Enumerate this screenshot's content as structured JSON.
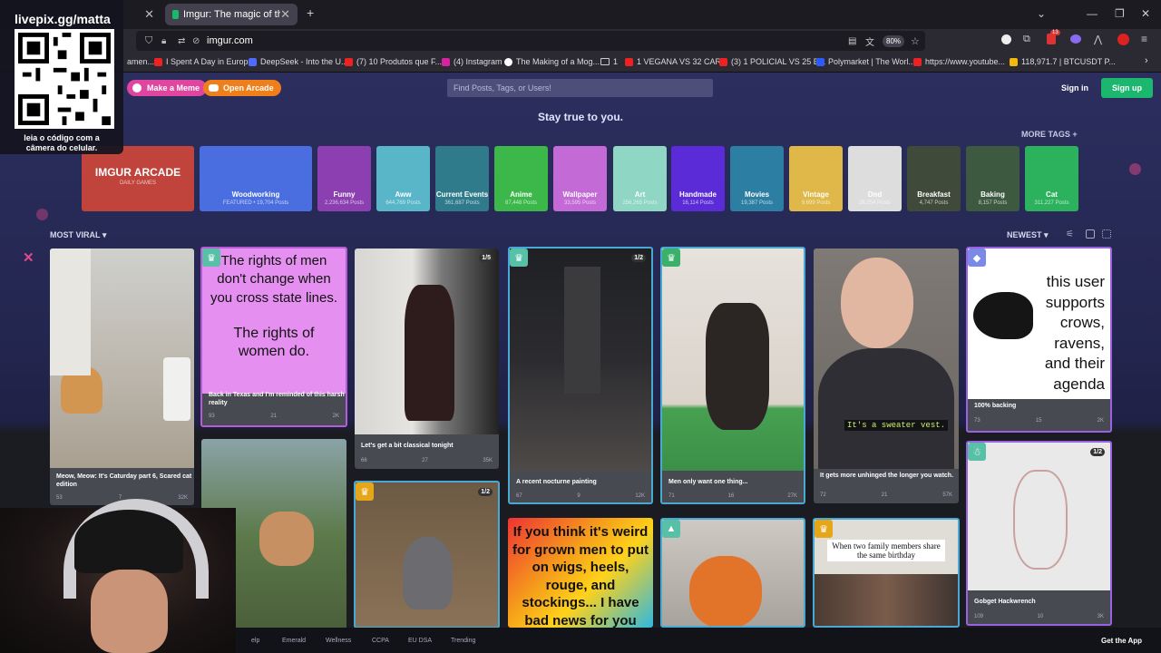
{
  "browser": {
    "tabs": [
      {
        "label": "",
        "active": false
      },
      {
        "label": "Imgur: The magic of the Interne",
        "active": true
      }
    ],
    "new_tab": "+",
    "url": "imgur.com",
    "zoom": "80%",
    "bookmarks": [
      {
        "label": "amen...",
        "color": "#c33"
      },
      {
        "label": "I Spent A Day in Europ...",
        "color": "#e22"
      },
      {
        "label": "DeepSeek - Into the U...",
        "color": "#4d6bfe"
      },
      {
        "label": "(7) 10 Produtos que F...",
        "color": "#e22"
      },
      {
        "label": "(4) Instagram",
        "color": "#d6249f"
      },
      {
        "label": "The Making of a Mog...",
        "color": "#fff"
      },
      {
        "label": "1",
        "color": "#aaa"
      },
      {
        "label": "1 VEGANA VS 32 CAR...",
        "color": "#e22"
      },
      {
        "label": "(3) 1 POLICIAL VS 25 E...",
        "color": "#e22"
      },
      {
        "label": "Polymarket | The Worl...",
        "color": "#2e5bff"
      },
      {
        "label": "https://www.youtube...",
        "color": "#e22"
      },
      {
        "label": "118,971.7 | BTCUSDT P...",
        "color": "#f0b90b"
      }
    ],
    "ext_badge": "13"
  },
  "header": {
    "make_meme": "Make a Meme",
    "open_arcade": "Open Arcade",
    "search_placeholder": "Find Posts, Tags, or Users!",
    "sign_in": "Sign in",
    "sign_up": "Sign up",
    "tagline": "Stay true to you.",
    "more_tags": "MORE TAGS +"
  },
  "tags": [
    {
      "name": "IMGUR ARCADE",
      "count": "DAILY GAMES",
      "color": "#c0443c"
    },
    {
      "name": "Woodworking",
      "count": "FEATURED • 19,704 Posts",
      "color": "#4a6ee0"
    },
    {
      "name": "Funny",
      "count": "2,236,634 Posts",
      "color": "#8b3fb0"
    },
    {
      "name": "Aww",
      "count": "644,769 Posts",
      "color": "#59b6c8"
    },
    {
      "name": "Current Events",
      "count": "361,687 Posts",
      "color": "#2f7b8c"
    },
    {
      "name": "Anime",
      "count": "87,448 Posts",
      "color": "#3cb84a"
    },
    {
      "name": "Wallpaper",
      "count": "33,595 Posts",
      "color": "#c36ad6"
    },
    {
      "name": "Art",
      "count": "256,265 Posts",
      "color": "#8fd6c4"
    },
    {
      "name": "Handmade",
      "count": "16,114 Posts",
      "color": "#5a2bd6"
    },
    {
      "name": "Movies",
      "count": "19,387 Posts",
      "color": "#2c7fa3"
    },
    {
      "name": "Vintage",
      "count": "9,699 Posts",
      "color": "#e0b84a"
    },
    {
      "name": "Dnd",
      "count": "26,254 Posts",
      "color": "#ddd"
    },
    {
      "name": "Breakfast",
      "count": "4,747 Posts",
      "color": "#3f4a3a"
    },
    {
      "name": "Baking",
      "count": "8,157 Posts",
      "color": "#3d5a40"
    },
    {
      "name": "Cat",
      "count": "311,227 Posts",
      "color": "#2cb25c"
    }
  ],
  "feed": {
    "sort_left": "MOST VIRAL",
    "sort_right": "NEWEST",
    "posts": [
      {
        "title": "Meow, Meow: It's Caturday part 6, Scared cat edition",
        "up": "53",
        "comments": "7",
        "views": "32K"
      },
      {
        "title": "Back in Texas and I'm reminded of this harsh reality",
        "up": "93",
        "comments": "21",
        "views": "2K",
        "text1": "The rights of men don't change when you cross state lines.",
        "text2": "The rights of women do."
      },
      {
        "title": "Let's get a bit classical tonight",
        "up": "66",
        "comments": "27",
        "views": "35K",
        "count": "1/5"
      },
      {
        "title": "A recent nocturne painting",
        "up": "67",
        "comments": "9",
        "views": "12K",
        "count": "1/2"
      },
      {
        "title": "Men only want one thing...",
        "up": "71",
        "comments": "16",
        "views": "27K"
      },
      {
        "title": "It gets more unhinged the longer you watch.",
        "up": "72",
        "comments": "21",
        "views": "57K",
        "caption": "It's a sweater vest."
      },
      {
        "title": "100% backing",
        "up": "73",
        "comments": "15",
        "views": "2K",
        "text1": "this user supports crows, ravens, and their agenda"
      },
      {
        "title": "Gobget Hackwrench",
        "up": "109",
        "comments": "10",
        "views": "3K",
        "count": "1/2"
      },
      {
        "count": "1/2"
      },
      {
        "text1": "If you think it's weird for grown men to put on wigs, heels, rouge, and stockings... I have bad news for you"
      },
      {
        "text1": "When two family members share the same birthday"
      }
    ]
  },
  "footer": {
    "items": [
      "elp",
      "Emerald",
      "Wellness",
      "CCPA",
      "EU DSA",
      "Trending"
    ],
    "get_app": "Get the App"
  },
  "overlay": {
    "qr_title": "livepix.gg/matta",
    "qr_caption": "leia o código com a câmera do celular."
  }
}
